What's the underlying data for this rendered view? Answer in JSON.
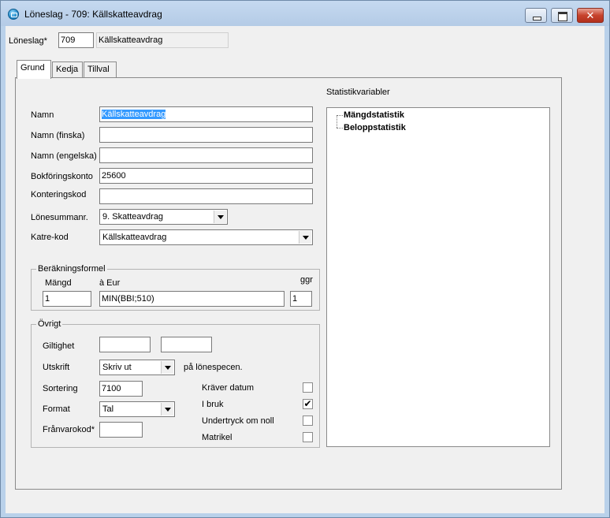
{
  "window": {
    "title": "Löneslag - 709: Källskatteavdrag"
  },
  "header": {
    "loneslag_label": "Löneslag*",
    "loneslag_code": "709",
    "loneslag_name": "Källskatteavdrag"
  },
  "tabs": [
    {
      "label": "Grund",
      "active": true
    },
    {
      "label": "Kedja",
      "active": false
    },
    {
      "label": "Tillval",
      "active": false
    }
  ],
  "grund": {
    "namn_label": "Namn",
    "namn_value": "Källskatteavdrag",
    "namn_finska_label": "Namn (finska)",
    "namn_finska_value": "",
    "namn_engelska_label": "Namn (engelska)",
    "namn_engelska_value": "",
    "bokforingskonto_label": "Bokföringskonto",
    "bokforingskonto_value": "25600",
    "konteringskod_label": "Konteringskod",
    "konteringskod_value": "",
    "lonesummanr_label": "Lönesummanr.",
    "lonesummanr_value": "9. Skatteavdrag",
    "katre_label": "Katre-kod",
    "katre_value": "Källskatteavdrag"
  },
  "berakning": {
    "title": "Beräkningsformel",
    "mangd_label": "Mängd",
    "mangd_value": "1",
    "eur_label": "à Eur",
    "eur_value": "MIN(BBI;510)",
    "ggr_label": "ggr",
    "ggr_value": "1"
  },
  "ovrigt": {
    "title": "Övrigt",
    "giltighet_label": "Giltighet",
    "giltighet_from": "",
    "giltighet_to": "",
    "utskrift_label": "Utskrift",
    "utskrift_value": "Skriv ut",
    "utskrift_suffix": "på lönespecen.",
    "sortering_label": "Sortering",
    "sortering_value": "7100",
    "format_label": "Format",
    "format_value": "Tal",
    "franvarokod_label": "Frånvarokod*",
    "franvarokod_value": "",
    "kraver_datum_label": "Kräver datum",
    "kraver_datum_checked": false,
    "i_bruk_label": "I bruk",
    "i_bruk_checked": true,
    "undertryck_label": "Undertryck om noll",
    "undertryck_checked": false,
    "matrikel_label": "Matrikel",
    "matrikel_checked": false
  },
  "statistik": {
    "title": "Statistikvariabler",
    "items": [
      "Mängdstatistik",
      "Beloppstatistik"
    ]
  },
  "colors": {
    "titlebar": "#b9d1ea",
    "selection": "#3399ff",
    "close_button": "#c7432d"
  }
}
